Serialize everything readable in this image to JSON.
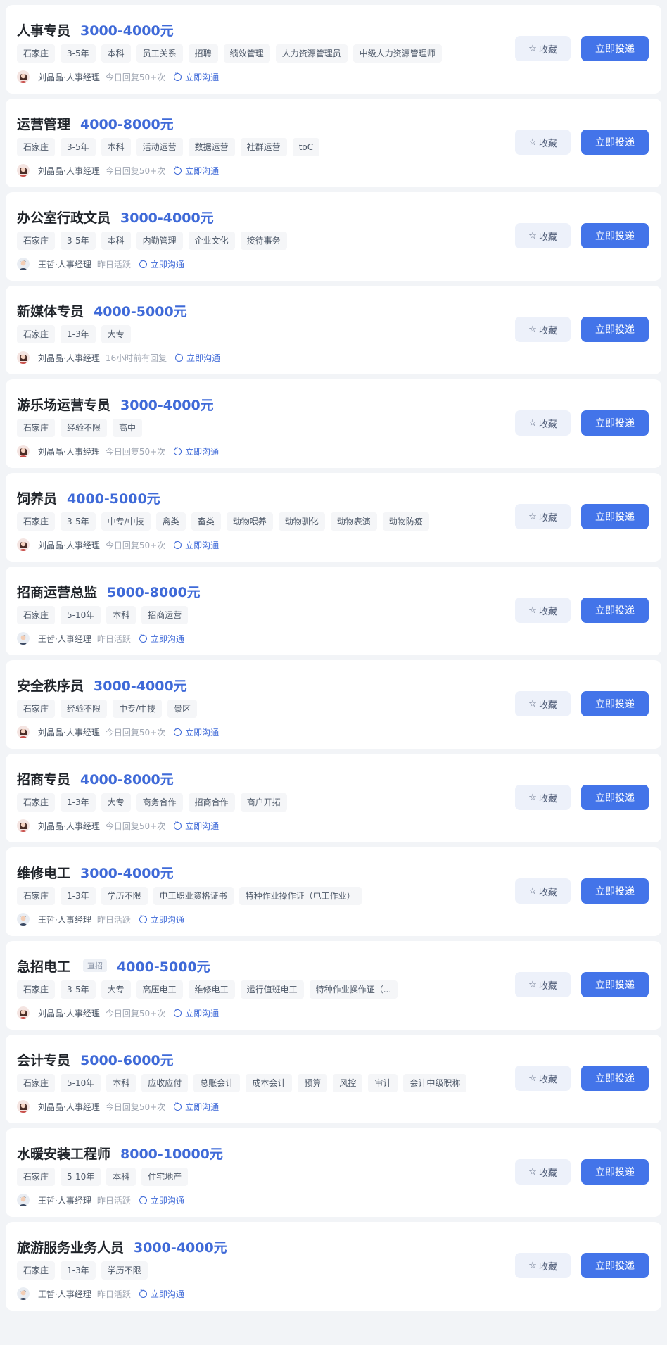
{
  "labels": {
    "favorite": "收藏",
    "apply": "立即投递",
    "chat": "立即沟通"
  },
  "colors": {
    "accent": "#4374e9",
    "salary": "#3f6ad8",
    "background": "#f2f4f7"
  },
  "jobs": [
    {
      "title": "人事专员",
      "salary": "3000-4000元",
      "badge": "",
      "tags": [
        "石家庄",
        "3-5年",
        "本科",
        "员工关系",
        "招聘",
        "绩效管理",
        "人力资源管理员",
        "中级人力资源管理师"
      ],
      "recruiter": "刘晶晶·人事经理",
      "recruiter_avatar": "female-avatar-icon",
      "activity": "今日回复50+次"
    },
    {
      "title": "运营管理",
      "salary": "4000-8000元",
      "badge": "",
      "tags": [
        "石家庄",
        "3-5年",
        "本科",
        "活动运营",
        "数据运营",
        "社群运营",
        "toC"
      ],
      "recruiter": "刘晶晶·人事经理",
      "recruiter_avatar": "female-avatar-icon",
      "activity": "今日回复50+次"
    },
    {
      "title": "办公室行政文员",
      "salary": "3000-4000元",
      "badge": "",
      "tags": [
        "石家庄",
        "3-5年",
        "本科",
        "内勤管理",
        "企业文化",
        "接待事务"
      ],
      "recruiter": "王哲·人事经理",
      "recruiter_avatar": "male-avatar-icon",
      "activity": "昨日活跃"
    },
    {
      "title": "新媒体专员",
      "salary": "4000-5000元",
      "badge": "",
      "tags": [
        "石家庄",
        "1-3年",
        "大专"
      ],
      "recruiter": "刘晶晶·人事经理",
      "recruiter_avatar": "female-avatar-icon",
      "activity": "16小时前有回复"
    },
    {
      "title": "游乐场运营专员",
      "salary": "3000-4000元",
      "badge": "",
      "tags": [
        "石家庄",
        "经验不限",
        "高中"
      ],
      "recruiter": "刘晶晶·人事经理",
      "recruiter_avatar": "female-avatar-icon",
      "activity": "今日回复50+次"
    },
    {
      "title": "饲养员",
      "salary": "4000-5000元",
      "badge": "",
      "tags": [
        "石家庄",
        "3-5年",
        "中专/中技",
        "禽类",
        "畜类",
        "动物喂养",
        "动物驯化",
        "动物表演",
        "动物防疫"
      ],
      "recruiter": "刘晶晶·人事经理",
      "recruiter_avatar": "female-avatar-icon",
      "activity": "今日回复50+次"
    },
    {
      "title": "招商运营总监",
      "salary": "5000-8000元",
      "badge": "",
      "tags": [
        "石家庄",
        "5-10年",
        "本科",
        "招商运营"
      ],
      "recruiter": "王哲·人事经理",
      "recruiter_avatar": "male-avatar-icon",
      "activity": "昨日活跃"
    },
    {
      "title": "安全秩序员",
      "salary": "3000-4000元",
      "badge": "",
      "tags": [
        "石家庄",
        "经验不限",
        "中专/中技",
        "景区"
      ],
      "recruiter": "刘晶晶·人事经理",
      "recruiter_avatar": "female-avatar-icon",
      "activity": "今日回复50+次"
    },
    {
      "title": "招商专员",
      "salary": "4000-8000元",
      "badge": "",
      "tags": [
        "石家庄",
        "1-3年",
        "大专",
        "商务合作",
        "招商合作",
        "商户开拓"
      ],
      "recruiter": "刘晶晶·人事经理",
      "recruiter_avatar": "female-avatar-icon",
      "activity": "今日回复50+次"
    },
    {
      "title": "维修电工",
      "salary": "3000-4000元",
      "badge": "",
      "tags": [
        "石家庄",
        "1-3年",
        "学历不限",
        "电工职业资格证书",
        "特种作业操作证（电工作业）"
      ],
      "recruiter": "王哲·人事经理",
      "recruiter_avatar": "male-avatar-icon",
      "activity": "昨日活跃"
    },
    {
      "title": "急招电工",
      "salary": "4000-5000元",
      "badge": "直招",
      "tags": [
        "石家庄",
        "3-5年",
        "大专",
        "高压电工",
        "维修电工",
        "运行值班电工",
        "特种作业操作证（..."
      ],
      "recruiter": "刘晶晶·人事经理",
      "recruiter_avatar": "female-avatar-icon",
      "activity": "今日回复50+次"
    },
    {
      "title": "会计专员",
      "salary": "5000-6000元",
      "badge": "",
      "tags": [
        "石家庄",
        "5-10年",
        "本科",
        "应收应付",
        "总账会计",
        "成本会计",
        "预算",
        "风控",
        "审计",
        "会计中级职称"
      ],
      "recruiter": "刘晶晶·人事经理",
      "recruiter_avatar": "female-avatar-icon",
      "activity": "今日回复50+次"
    },
    {
      "title": "水暖安装工程师",
      "salary": "8000-10000元",
      "badge": "",
      "tags": [
        "石家庄",
        "5-10年",
        "本科",
        "住宅地产"
      ],
      "recruiter": "王哲·人事经理",
      "recruiter_avatar": "male-avatar-icon",
      "activity": "昨日活跃"
    },
    {
      "title": "旅游服务业务人员",
      "salary": "3000-4000元",
      "badge": "",
      "tags": [
        "石家庄",
        "1-3年",
        "学历不限"
      ],
      "recruiter": "王哲·人事经理",
      "recruiter_avatar": "male-avatar-icon",
      "activity": "昨日活跃"
    }
  ]
}
